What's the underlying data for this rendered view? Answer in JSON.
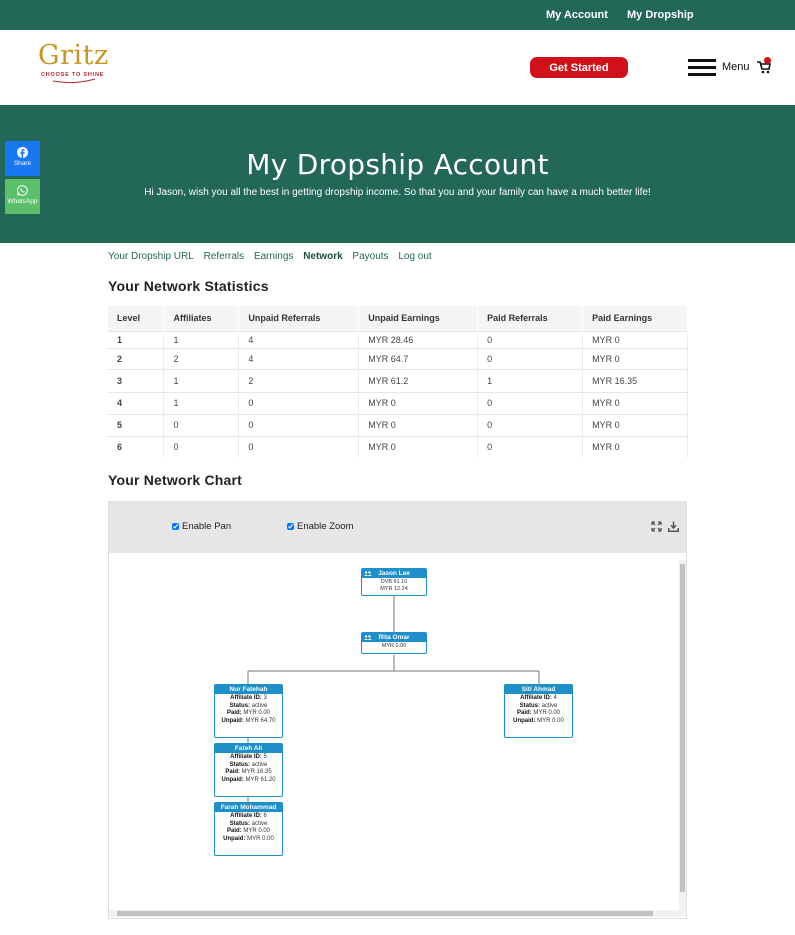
{
  "topbar": {
    "my_account": "My Account",
    "my_dropship": "My Dropship"
  },
  "brand": {
    "name": "Gritz",
    "tagline": "CHOOSE TO SHINE",
    "gold": "#c8961e",
    "red": "#b4282d"
  },
  "header": {
    "cta": "Get Started",
    "menu": "Menu",
    "accent": "#d0101b"
  },
  "hero": {
    "title": "My Dropship Account",
    "subtitle": "Hi Jason, wish you all the best in getting dropship income. So that you and your family can have a much better life!",
    "bg": "#236757"
  },
  "social": {
    "share": "Share",
    "whatsapp": "WhatsApp"
  },
  "tabs": [
    {
      "label": "Your Dropship URL",
      "active": false
    },
    {
      "label": "Referrals",
      "active": false
    },
    {
      "label": "Earnings",
      "active": false
    },
    {
      "label": "Network",
      "active": true
    },
    {
      "label": "Payouts",
      "active": false
    },
    {
      "label": "Log out",
      "active": false
    }
  ],
  "stats": {
    "title": "Your Network Statistics",
    "columns": [
      "Level",
      "Affiliates",
      "Unpaid Referrals",
      "Unpaid Earnings",
      "Paid Referrals",
      "Paid Earnings"
    ],
    "rows": [
      [
        "1",
        "1",
        "4",
        "MYR 28.46",
        "0",
        "MYR 0"
      ],
      [
        "2",
        "2",
        "4",
        "MYR 64.7",
        "0",
        "MYR 0"
      ],
      [
        "3",
        "1",
        "2",
        "MYR 61.2",
        "1",
        "MYR 16.35"
      ],
      [
        "4",
        "1",
        "0",
        "MYR 0",
        "0",
        "MYR 0"
      ],
      [
        "5",
        "0",
        "0",
        "MYR 0",
        "0",
        "MYR 0"
      ],
      [
        "6",
        "0",
        "0",
        "MYR 0",
        "0",
        "MYR 0"
      ]
    ]
  },
  "chart": {
    "title": "Your Network Chart",
    "enable_pan": "Enable Pan",
    "enable_zoom": "Enable Zoom",
    "node_color": "#1e8fc9",
    "labels": {
      "affiliate_id": "Affiliate ID:",
      "status": "Status:",
      "paid": "Paid:",
      "unpaid": "Unpaid:"
    },
    "nodes": {
      "root": {
        "name": "Jason Lee",
        "line1": "DVB 91.10",
        "line2": "MYR 12.24"
      },
      "rita": {
        "name": "Rita Omar",
        "line1": "MYR 0.00"
      },
      "nur": {
        "name": "Nur Fatehah",
        "id": "3",
        "status": "active",
        "paid": "MYR 0.00",
        "unpaid": "MYR 64.70"
      },
      "siti": {
        "name": "Siti Ahmad",
        "id": "4",
        "status": "active",
        "paid": "MYR 0.00",
        "unpaid": "MYR 0.00"
      },
      "fateh": {
        "name": "Fateh Ali",
        "id": "5",
        "status": "active",
        "paid": "MYR 16.35",
        "unpaid": "MYR 61.20"
      },
      "farah": {
        "name": "Farah Mohammad",
        "id": "6",
        "status": "active",
        "paid": "MYR 0.00",
        "unpaid": "MYR 0.00"
      }
    }
  }
}
